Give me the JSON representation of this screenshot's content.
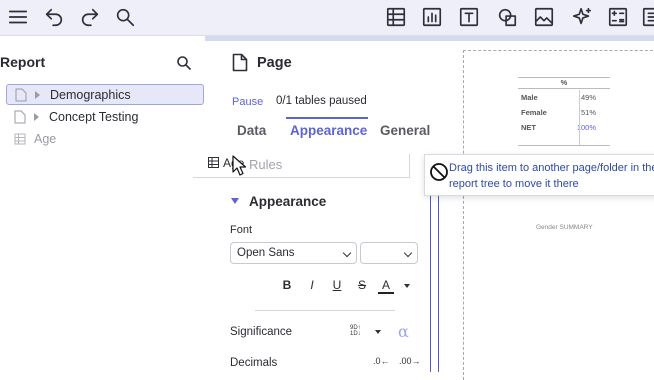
{
  "toolbar": {
    "icons": [
      "menu-icon",
      "undo-icon",
      "redo-icon",
      "search-icon",
      "table-icon",
      "chart-icon",
      "text-icon",
      "shapes-icon",
      "image-icon",
      "sparkle-icon",
      "calculation-icon",
      "exit-icon"
    ]
  },
  "tree": {
    "title": "Report",
    "items": [
      {
        "label": "Demographics",
        "selected": true
      },
      {
        "label": "Concept Testing",
        "selected": false
      },
      {
        "label": "Age",
        "disabled": true
      }
    ]
  },
  "panel": {
    "page_title": "Page",
    "pause_label": "Pause",
    "paused_status": "0/1 tables paused",
    "tabs": [
      {
        "label": "Data",
        "active": false
      },
      {
        "label": "Appearance",
        "active": true
      },
      {
        "label": "General",
        "active": false
      }
    ],
    "drag_ghost_label": "Age",
    "rules_label": "Rules",
    "appearance_heading": "Appearance",
    "font_label": "Font",
    "font_value": "Open Sans",
    "size_value": "",
    "format_buttons": [
      "B",
      "I",
      "U",
      "S",
      "A"
    ],
    "significance_label": "Significance",
    "significance_icon_text": "9D↑ 1D↓",
    "decimals_label": "Decimals",
    "decimals_decrease": ".0←",
    "decimals_increase": ".00→"
  },
  "canvas": {
    "mini_table": {
      "header": "%",
      "rows": [
        {
          "label": "Male",
          "value": "49%"
        },
        {
          "label": "Female",
          "value": "51%"
        },
        {
          "label": "NET",
          "value": "100%"
        }
      ],
      "footer": "Gender SUMMARY"
    }
  },
  "tooltip": {
    "text": "Drag this item to another page/folder in the report tree to move it there"
  },
  "colors": {
    "accent": "#5d63d6",
    "toolbar_bg": "#eeeff8",
    "tooltip_text": "#2e4aa8"
  }
}
